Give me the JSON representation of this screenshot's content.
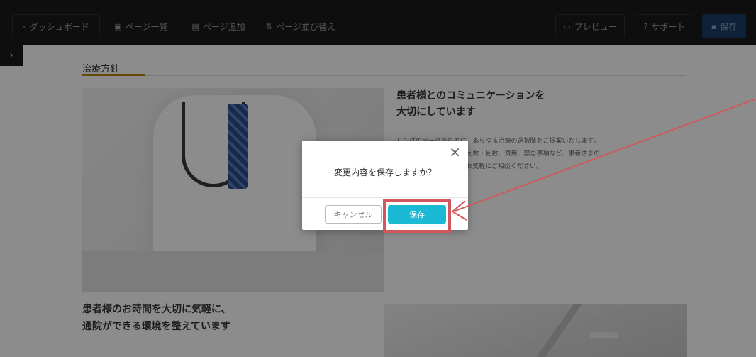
{
  "toolbar": {
    "dashboard_label": "ダッシュボード",
    "page_list_label": "ページ一覧",
    "add_page_label": "ページ追加",
    "reorder_label": "ページ並び替え",
    "preview_label": "プレビュー",
    "support_label": "サポート",
    "save_label": "保存"
  },
  "page": {
    "section_title": "治療方針",
    "heading1_line1": "患者様とのコミュニケーションを",
    "heading1_line2": "大切にしています",
    "body1_line1": "リングのデータをもとに、あらゆる治療の選択肢をご提案いたします。",
    "body1_line2": "含めて、治療期間、治療回数・回数、費用、禁忌事項など、患者さまの",
    "body1_line3": "法をご提案いたします。お気軽にご相談ください。",
    "heading2_line1": "患者様のお時間を大切に気軽に、",
    "heading2_line2": "通院ができる環境を整えています"
  },
  "modal": {
    "message": "変更内容を保存しますか？",
    "cancel_label": "キャンセル",
    "save_label": "保存",
    "close_icon": "×"
  },
  "colors": {
    "toolbar_bg": "#1b1b1b",
    "save_button": "#1ab9d4",
    "annotation": "#d0585d"
  }
}
